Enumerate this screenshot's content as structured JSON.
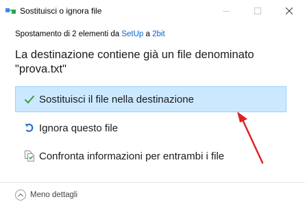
{
  "window": {
    "title": "Sostituisci o ignora file"
  },
  "moving": {
    "prefix": "Spostamento di 2 elementi da ",
    "source": "SetUp",
    "middle": " a ",
    "destination": "2bit"
  },
  "heading": {
    "line1": "La destinazione contiene già un file denominato",
    "line2": "\"prova.txt\""
  },
  "options": [
    {
      "label": "Sostituisci il file nella destinazione",
      "icon": "checkmark-icon",
      "selected": true
    },
    {
      "label": "Ignora questo file",
      "icon": "skip-arrow-icon",
      "selected": false
    },
    {
      "label": "Confronta informazioni per entrambi i file",
      "icon": "compare-files-icon",
      "selected": false
    }
  ],
  "footer": {
    "less_details": "Meno dettagli"
  },
  "colors": {
    "selected_bg": "#cce8ff",
    "selected_border": "#99d1ff",
    "link": "#0066cc",
    "checkmark": "#3c9a3c",
    "annotation_arrow": "#e02020"
  }
}
